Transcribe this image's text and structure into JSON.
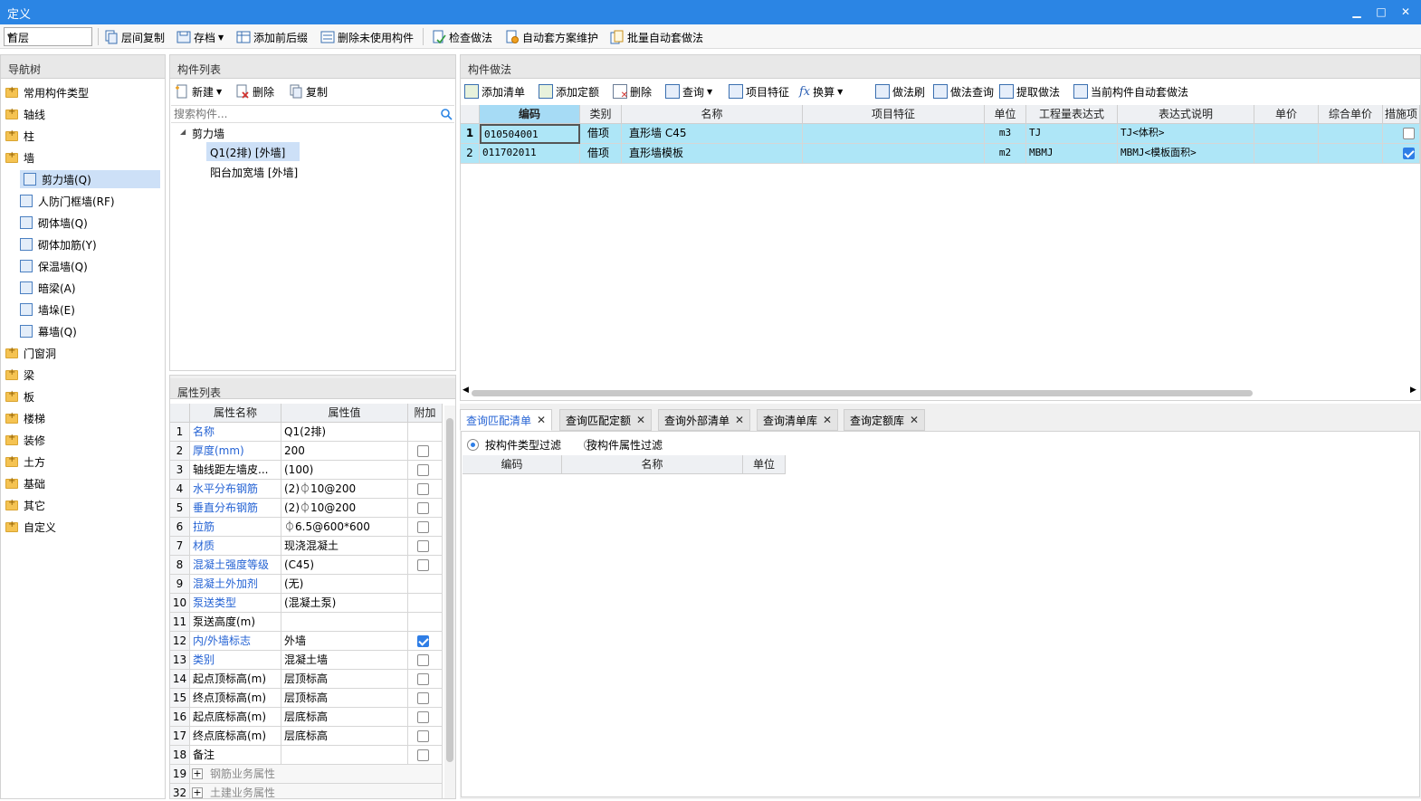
{
  "window": {
    "title": "定义",
    "min": "▁",
    "max": "□",
    "close": "✕"
  },
  "toolbar": {
    "floor": "首层",
    "floor_copy": "层间复制",
    "save": "存档",
    "add_prefix_suffix": "添加前后缀",
    "delete_unused": "删除未使用构件",
    "check_method": "检查做法",
    "auto_scheme": "自动套方案维护",
    "batch_auto": "批量自动套做法"
  },
  "nav": {
    "header": "导航树",
    "items": [
      {
        "label": "常用构件类型"
      },
      {
        "label": "轴线"
      },
      {
        "label": "柱"
      },
      {
        "label": "墙"
      },
      {
        "label": "剪力墙(Q)"
      },
      {
        "label": "人防门框墙(RF)"
      },
      {
        "label": "砌体墙(Q)"
      },
      {
        "label": "砌体加筋(Y)"
      },
      {
        "label": "保温墙(Q)"
      },
      {
        "label": "暗梁(A)"
      },
      {
        "label": "墙垛(E)"
      },
      {
        "label": "幕墙(Q)"
      },
      {
        "label": "门窗洞"
      },
      {
        "label": "梁"
      },
      {
        "label": "板"
      },
      {
        "label": "楼梯"
      },
      {
        "label": "装修"
      },
      {
        "label": "土方"
      },
      {
        "label": "基础"
      },
      {
        "label": "其它"
      },
      {
        "label": "自定义"
      }
    ]
  },
  "components": {
    "header": "构件列表",
    "new": "新建",
    "delete": "删除",
    "copy": "复制",
    "search_placeholder": "搜索构件...",
    "tree_root": "剪力墙",
    "tree_items": [
      "Q1(2排) [外墙]",
      "阳台加宽墙 [外墙]"
    ]
  },
  "properties": {
    "header": "属性列表",
    "col_name": "属性名称",
    "col_value": "属性值",
    "col_extra": "附加",
    "rows": [
      {
        "no": "1",
        "name": "名称",
        "value": "Q1(2排)",
        "check": ""
      },
      {
        "no": "2",
        "name": "厚度(mm)",
        "value": "200",
        "check": "off"
      },
      {
        "no": "3",
        "name": "轴线距左墙皮...",
        "value": "(100)",
        "check": "off"
      },
      {
        "no": "4",
        "name": "水平分布钢筋",
        "value": "(2)⏀10@200",
        "check": "off"
      },
      {
        "no": "5",
        "name": "垂直分布钢筋",
        "value": "(2)⏀10@200",
        "check": "off"
      },
      {
        "no": "6",
        "name": "拉筋",
        "value": "⏀6.5@600*600",
        "check": "off"
      },
      {
        "no": "7",
        "name": "材质",
        "value": "现浇混凝土",
        "check": "off"
      },
      {
        "no": "8",
        "name": "混凝土强度等级",
        "value": "(C45)",
        "check": "off"
      },
      {
        "no": "9",
        "name": "混凝土外加剂",
        "value": "(无)",
        "check": ""
      },
      {
        "no": "10",
        "name": "泵送类型",
        "value": "(混凝土泵)",
        "check": ""
      },
      {
        "no": "11",
        "name": "泵送高度(m)",
        "value": "",
        "check": ""
      },
      {
        "no": "12",
        "name": "内/外墙标志",
        "value": "外墙",
        "check": "on"
      },
      {
        "no": "13",
        "name": "类别",
        "value": "混凝土墙",
        "check": "off"
      },
      {
        "no": "14",
        "name": "起点顶标高(m)",
        "value": "层顶标高",
        "check": "off"
      },
      {
        "no": "15",
        "name": "终点顶标高(m)",
        "value": "层顶标高",
        "check": "off"
      },
      {
        "no": "16",
        "name": "起点底标高(m)",
        "value": "层底标高",
        "check": "off"
      },
      {
        "no": "17",
        "name": "终点底标高(m)",
        "value": "层底标高",
        "check": "off"
      },
      {
        "no": "18",
        "name": "备注",
        "value": "",
        "check": "off"
      },
      {
        "no": "19",
        "name": "钢筋业务属性",
        "value": "",
        "check": ""
      },
      {
        "no": "32",
        "name": "土建业务属性",
        "value": "",
        "check": ""
      }
    ]
  },
  "method": {
    "header": "构件做法",
    "toolbar": [
      "添加清单",
      "添加定额",
      "删除",
      "查询",
      "项目特征",
      "换算",
      "做法刷",
      "做法查询",
      "提取做法",
      "当前构件自动套做法"
    ],
    "columns": [
      "编码",
      "类别",
      "名称",
      "项目特征",
      "单位",
      "工程量表达式",
      "表达式说明",
      "单价",
      "综合单价",
      "措施项"
    ],
    "rows": [
      {
        "no": "1",
        "code": "010504001",
        "type": "借项",
        "name": "直形墙 C45",
        "feature": "",
        "unit": "m3",
        "expr": "TJ",
        "desc": "TJ<体积>",
        "price": "",
        "total": "",
        "measure": "off"
      },
      {
        "no": "2",
        "code": "011702011",
        "type": "借项",
        "name": "直形墙模板",
        "feature": "",
        "unit": "m2",
        "expr": "MBMJ",
        "desc": "MBMJ<模板面积>",
        "price": "",
        "total": "",
        "measure": "on"
      }
    ]
  },
  "query": {
    "tabs": [
      "查询匹配清单",
      "查询匹配定额",
      "查询外部清单",
      "查询清单库",
      "查询定额库"
    ],
    "filter_type": "按构件类型过滤",
    "filter_attr": "按构件属性过滤",
    "columns": [
      "编码",
      "名称",
      "单位"
    ]
  },
  "colors": {
    "titlebar": "#2b85e4",
    "row_highlight": "#aee6f7",
    "selected_header": "#a6dbf5",
    "link": "#2563d4"
  }
}
